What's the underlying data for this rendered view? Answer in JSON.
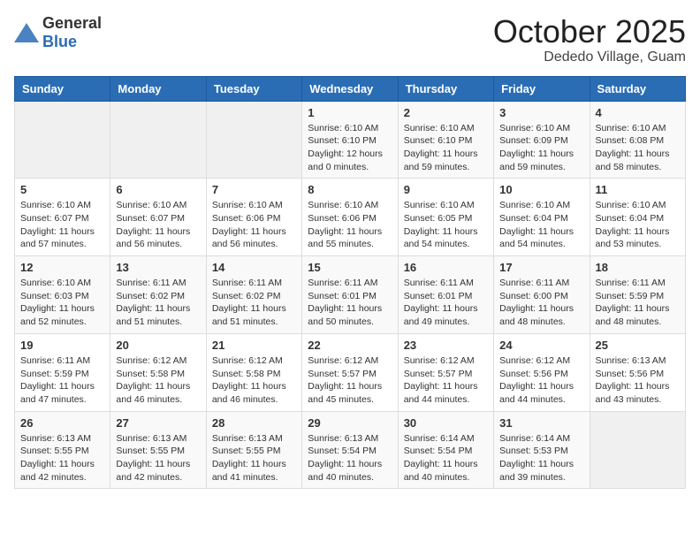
{
  "logo": {
    "general": "General",
    "blue": "Blue"
  },
  "header": {
    "month": "October 2025",
    "location": "Dededo Village, Guam"
  },
  "weekdays": [
    "Sunday",
    "Monday",
    "Tuesday",
    "Wednesday",
    "Thursday",
    "Friday",
    "Saturday"
  ],
  "weeks": [
    [
      {
        "day": "",
        "sunrise": "",
        "sunset": "",
        "daylight": ""
      },
      {
        "day": "",
        "sunrise": "",
        "sunset": "",
        "daylight": ""
      },
      {
        "day": "",
        "sunrise": "",
        "sunset": "",
        "daylight": ""
      },
      {
        "day": "1",
        "sunrise": "Sunrise: 6:10 AM",
        "sunset": "Sunset: 6:10 PM",
        "daylight": "Daylight: 12 hours and 0 minutes."
      },
      {
        "day": "2",
        "sunrise": "Sunrise: 6:10 AM",
        "sunset": "Sunset: 6:10 PM",
        "daylight": "Daylight: 11 hours and 59 minutes."
      },
      {
        "day": "3",
        "sunrise": "Sunrise: 6:10 AM",
        "sunset": "Sunset: 6:09 PM",
        "daylight": "Daylight: 11 hours and 59 minutes."
      },
      {
        "day": "4",
        "sunrise": "Sunrise: 6:10 AM",
        "sunset": "Sunset: 6:08 PM",
        "daylight": "Daylight: 11 hours and 58 minutes."
      }
    ],
    [
      {
        "day": "5",
        "sunrise": "Sunrise: 6:10 AM",
        "sunset": "Sunset: 6:07 PM",
        "daylight": "Daylight: 11 hours and 57 minutes."
      },
      {
        "day": "6",
        "sunrise": "Sunrise: 6:10 AM",
        "sunset": "Sunset: 6:07 PM",
        "daylight": "Daylight: 11 hours and 56 minutes."
      },
      {
        "day": "7",
        "sunrise": "Sunrise: 6:10 AM",
        "sunset": "Sunset: 6:06 PM",
        "daylight": "Daylight: 11 hours and 56 minutes."
      },
      {
        "day": "8",
        "sunrise": "Sunrise: 6:10 AM",
        "sunset": "Sunset: 6:06 PM",
        "daylight": "Daylight: 11 hours and 55 minutes."
      },
      {
        "day": "9",
        "sunrise": "Sunrise: 6:10 AM",
        "sunset": "Sunset: 6:05 PM",
        "daylight": "Daylight: 11 hours and 54 minutes."
      },
      {
        "day": "10",
        "sunrise": "Sunrise: 6:10 AM",
        "sunset": "Sunset: 6:04 PM",
        "daylight": "Daylight: 11 hours and 54 minutes."
      },
      {
        "day": "11",
        "sunrise": "Sunrise: 6:10 AM",
        "sunset": "Sunset: 6:04 PM",
        "daylight": "Daylight: 11 hours and 53 minutes."
      }
    ],
    [
      {
        "day": "12",
        "sunrise": "Sunrise: 6:10 AM",
        "sunset": "Sunset: 6:03 PM",
        "daylight": "Daylight: 11 hours and 52 minutes."
      },
      {
        "day": "13",
        "sunrise": "Sunrise: 6:11 AM",
        "sunset": "Sunset: 6:02 PM",
        "daylight": "Daylight: 11 hours and 51 minutes."
      },
      {
        "day": "14",
        "sunrise": "Sunrise: 6:11 AM",
        "sunset": "Sunset: 6:02 PM",
        "daylight": "Daylight: 11 hours and 51 minutes."
      },
      {
        "day": "15",
        "sunrise": "Sunrise: 6:11 AM",
        "sunset": "Sunset: 6:01 PM",
        "daylight": "Daylight: 11 hours and 50 minutes."
      },
      {
        "day": "16",
        "sunrise": "Sunrise: 6:11 AM",
        "sunset": "Sunset: 6:01 PM",
        "daylight": "Daylight: 11 hours and 49 minutes."
      },
      {
        "day": "17",
        "sunrise": "Sunrise: 6:11 AM",
        "sunset": "Sunset: 6:00 PM",
        "daylight": "Daylight: 11 hours and 48 minutes."
      },
      {
        "day": "18",
        "sunrise": "Sunrise: 6:11 AM",
        "sunset": "Sunset: 5:59 PM",
        "daylight": "Daylight: 11 hours and 48 minutes."
      }
    ],
    [
      {
        "day": "19",
        "sunrise": "Sunrise: 6:11 AM",
        "sunset": "Sunset: 5:59 PM",
        "daylight": "Daylight: 11 hours and 47 minutes."
      },
      {
        "day": "20",
        "sunrise": "Sunrise: 6:12 AM",
        "sunset": "Sunset: 5:58 PM",
        "daylight": "Daylight: 11 hours and 46 minutes."
      },
      {
        "day": "21",
        "sunrise": "Sunrise: 6:12 AM",
        "sunset": "Sunset: 5:58 PM",
        "daylight": "Daylight: 11 hours and 46 minutes."
      },
      {
        "day": "22",
        "sunrise": "Sunrise: 6:12 AM",
        "sunset": "Sunset: 5:57 PM",
        "daylight": "Daylight: 11 hours and 45 minutes."
      },
      {
        "day": "23",
        "sunrise": "Sunrise: 6:12 AM",
        "sunset": "Sunset: 5:57 PM",
        "daylight": "Daylight: 11 hours and 44 minutes."
      },
      {
        "day": "24",
        "sunrise": "Sunrise: 6:12 AM",
        "sunset": "Sunset: 5:56 PM",
        "daylight": "Daylight: 11 hours and 44 minutes."
      },
      {
        "day": "25",
        "sunrise": "Sunrise: 6:13 AM",
        "sunset": "Sunset: 5:56 PM",
        "daylight": "Daylight: 11 hours and 43 minutes."
      }
    ],
    [
      {
        "day": "26",
        "sunrise": "Sunrise: 6:13 AM",
        "sunset": "Sunset: 5:55 PM",
        "daylight": "Daylight: 11 hours and 42 minutes."
      },
      {
        "day": "27",
        "sunrise": "Sunrise: 6:13 AM",
        "sunset": "Sunset: 5:55 PM",
        "daylight": "Daylight: 11 hours and 42 minutes."
      },
      {
        "day": "28",
        "sunrise": "Sunrise: 6:13 AM",
        "sunset": "Sunset: 5:55 PM",
        "daylight": "Daylight: 11 hours and 41 minutes."
      },
      {
        "day": "29",
        "sunrise": "Sunrise: 6:13 AM",
        "sunset": "Sunset: 5:54 PM",
        "daylight": "Daylight: 11 hours and 40 minutes."
      },
      {
        "day": "30",
        "sunrise": "Sunrise: 6:14 AM",
        "sunset": "Sunset: 5:54 PM",
        "daylight": "Daylight: 11 hours and 40 minutes."
      },
      {
        "day": "31",
        "sunrise": "Sunrise: 6:14 AM",
        "sunset": "Sunset: 5:53 PM",
        "daylight": "Daylight: 11 hours and 39 minutes."
      },
      {
        "day": "",
        "sunrise": "",
        "sunset": "",
        "daylight": ""
      }
    ]
  ]
}
